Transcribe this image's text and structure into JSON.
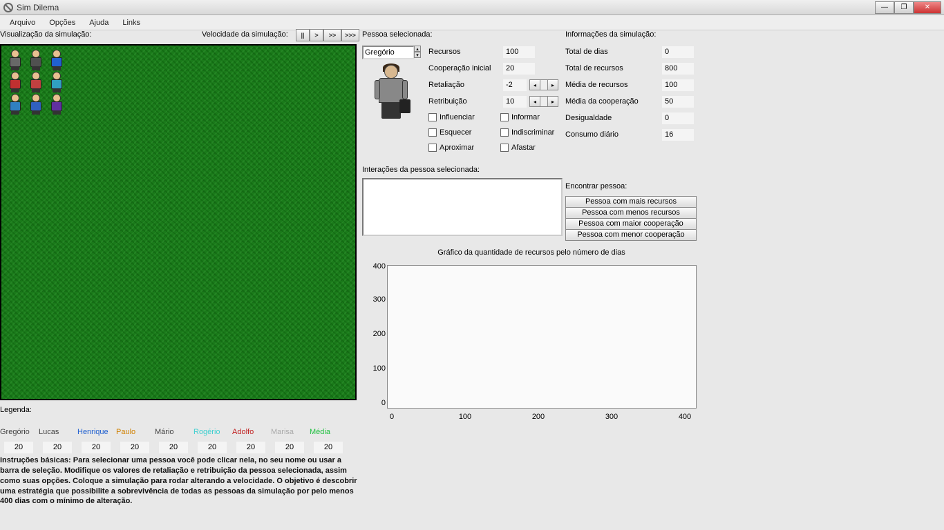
{
  "window": {
    "title": "Sim Dilema"
  },
  "menu": {
    "arquivo": "Arquivo",
    "opcoes": "Opções",
    "ajuda": "Ajuda",
    "links": "Links"
  },
  "labels": {
    "visualizacao": "Visualização da simulação:",
    "velocidade": "Velocidade da simulação:",
    "pessoa_sel": "Pessoa selecionada:",
    "info_sim": "Informações da simulação:",
    "interacoes": "Interações da pessoa selecionada:",
    "encontrar": "Encontrar pessoa:",
    "legenda": "Legenda:",
    "grafico": "Gráfico da quantidade de recursos pelo número de dias"
  },
  "speed": {
    "pause": "||",
    "play": ">",
    "ff": ">>",
    "fff": ">>>"
  },
  "person": {
    "selected": "Gregório",
    "stats": {
      "recursos_label": "Recursos",
      "recursos": "100",
      "coop_label": "Cooperação inicial",
      "coop": "20",
      "retal_label": "Retaliação",
      "retal": "-2",
      "retrib_label": "Retribuição",
      "retrib": "10"
    },
    "options": {
      "influenciar": "Influenciar",
      "informar": "Informar",
      "esquecer": "Esquecer",
      "indiscriminar": "Indiscriminar",
      "aproximar": "Aproximar",
      "afastar": "Afastar"
    }
  },
  "siminfo": {
    "total_dias_label": "Total de dias",
    "total_dias": "0",
    "total_rec_label": "Total de recursos",
    "total_rec": "800",
    "media_rec_label": "Média de recursos",
    "media_rec": "100",
    "media_coop_label": "Média da cooperação",
    "media_coop": "50",
    "desig_label": "Desigualdade",
    "desig": "0",
    "consumo_label": "Consumo diário",
    "consumo": "16"
  },
  "find": {
    "mais_rec": "Pessoa com mais recursos",
    "menos_rec": "Pessoa com menos recursos",
    "maior_coop": "Pessoa com maior cooperação",
    "menor_coop": "Pessoa com menor cooperação"
  },
  "legend": {
    "names": [
      "Gregório",
      "Lucas",
      "Henrique",
      "Paulo",
      "Mário",
      "Rogério",
      "Adolfo",
      "Marisa",
      "Média"
    ],
    "colors": [
      "#444444",
      "#444444",
      "#2060d0",
      "#d08000",
      "#444444",
      "#40d0d0",
      "#c02020",
      "#aaaaaa",
      "#20c040"
    ],
    "values": [
      "20",
      "20",
      "20",
      "20",
      "20",
      "20",
      "20",
      "20",
      "20"
    ]
  },
  "chart_data": {
    "type": "line",
    "title": "Gráfico da quantidade de recursos pelo número de dias",
    "xlabel": "",
    "ylabel": "",
    "xlim": [
      0,
      400
    ],
    "ylim": [
      0,
      400
    ],
    "x_ticks": [
      0,
      100,
      200,
      300,
      400
    ],
    "y_ticks": [
      0,
      100,
      200,
      300,
      400
    ],
    "series": []
  },
  "instructions": "Instruções básicas: Para selecionar uma pessoa você pode clicar nela, no seu nome ou usar a barra de seleção. Modifique os valores de retaliação e retribuição da pessoa selecionada, assim como suas opções. Coloque a simulação para rodar alterando a velocidade. O objetivo é descobrir uma estratégia que possibilite a sobrevivência de todas as pessoas da simulação por pelo menos 400 dias com o mínimo de alteração."
}
